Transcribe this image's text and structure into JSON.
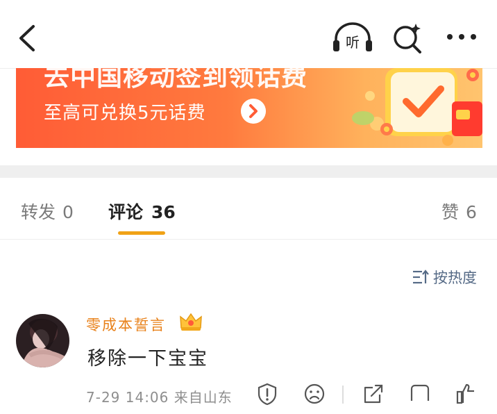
{
  "header": {
    "icons": [
      "chevron-left-icon",
      "headphones-listen-icon",
      "search-sparkle-icon",
      "more-icon"
    ],
    "listen_label": "听"
  },
  "banner": {
    "title": "去中国移动签到领话费",
    "subtitle": "至高可兑换5元话费"
  },
  "tabs": [
    {
      "label": "转发",
      "count": "0"
    },
    {
      "label": "评论",
      "count": "36",
      "active": true
    },
    {
      "label": "赞",
      "count": "6"
    }
  ],
  "sort": {
    "label": "按热度"
  },
  "comments": [
    {
      "username": "零成本誓言",
      "text": "移除一下宝宝",
      "meta": "7-29 14:06 来自山东"
    }
  ],
  "colors": {
    "accent": "#f0a216",
    "username": "#e8811a",
    "banner_start": "#ff5c36",
    "banner_end": "#ffc46e",
    "sort_text": "#556a86"
  }
}
